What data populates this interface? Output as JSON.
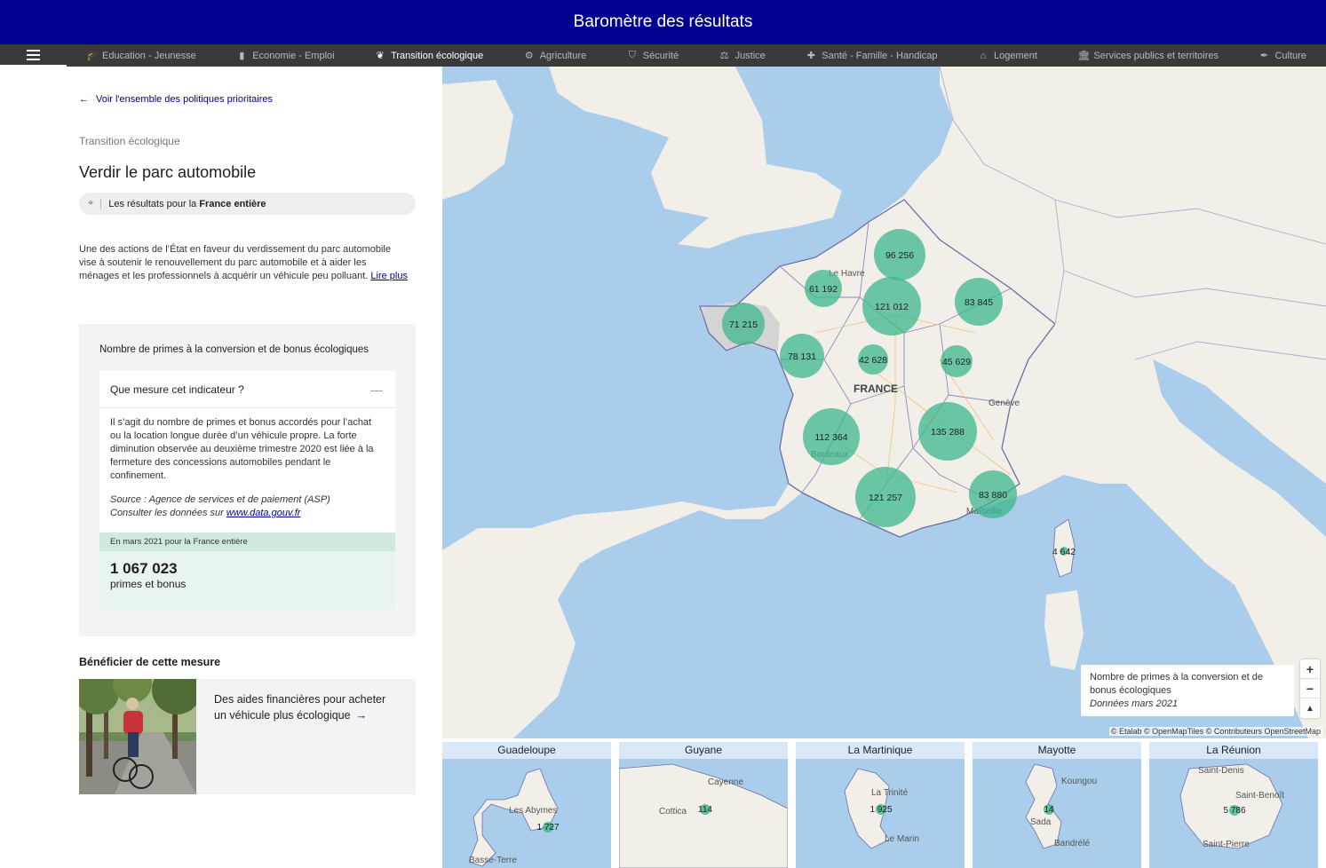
{
  "header": {
    "title": "Baromètre des résultats"
  },
  "nav": {
    "items": [
      {
        "label": "Education - Jeunesse",
        "icon": "graduation-cap-icon",
        "glyph": "🎓",
        "active": false
      },
      {
        "label": "Economie - Emploi",
        "icon": "briefcase-icon",
        "glyph": "▮",
        "active": false
      },
      {
        "label": "Transition écologique",
        "icon": "leaf-icon",
        "glyph": "❦",
        "active": true
      },
      {
        "label": "Agriculture",
        "icon": "tractor-icon",
        "glyph": "⚙",
        "active": false
      },
      {
        "label": "Sécurité",
        "icon": "shield-icon",
        "glyph": "⛉",
        "active": false
      },
      {
        "label": "Justice",
        "icon": "scale-icon",
        "glyph": "⚖",
        "active": false
      },
      {
        "label": "Santé - Famille - Handicap",
        "icon": "medical-case-icon",
        "glyph": "✚",
        "active": false
      },
      {
        "label": "Logement",
        "icon": "home-icon",
        "glyph": "⌂",
        "active": false
      },
      {
        "label": "Services publics et territoires",
        "icon": "building-icon",
        "glyph": "🏛",
        "active": false
      },
      {
        "label": "Culture",
        "icon": "feather-icon",
        "glyph": "✒",
        "active": false
      }
    ]
  },
  "sidebar": {
    "back_link": "Voir l'ensemble des politiques prioritaires",
    "category": "Transition écologique",
    "title": "Verdir le parc automobile",
    "scope_prefix": "Les résultats pour la",
    "scope_value": "France entière",
    "intro": "Une des actions de l’État en faveur du verdissement du parc automobile vise à soutenir le renouvellement du parc automobile et à aider les ménages et les professionnels à acquérir un véhicule peu polluant.",
    "read_more": "Lire plus",
    "indicator": {
      "title": "Nombre de primes à la conversion et de bonus écologiques",
      "accordion_title": "Que mesure cet indicateur ?",
      "description": "Il s’agit du nombre de primes et bonus accordés pour l’achat ou la location longue durée d’un véhicule propre. La forte diminution observée au deuxième trimestre 2020 est liée à la fermeture des concessions automobiles pendant le confinement.",
      "source": "Source : Agence de services et de paiement (ASP)",
      "data_prefix": "Consulter les données sur",
      "data_link": "www.data.gouv.fr",
      "value_caption": "En mars 2021 pour la France entière",
      "value": "1 067 023",
      "unit": "primes et bonus"
    },
    "benefit": {
      "title": "Bénéficier de cette mesure",
      "card_text": "Des aides financières pour acheter un véhicule plus écologique"
    }
  },
  "map": {
    "country_label": "FRANCE",
    "city_labels": [
      "Le Havre",
      "Bordeaux",
      "Genève",
      "Marseille"
    ],
    "clusters": [
      "96 256",
      "61 192",
      "121 012",
      "83 845",
      "71 215",
      "78 131",
      "42 628",
      "45 629",
      "112 364",
      "135 288",
      "121 257",
      "83 880",
      "4 642"
    ],
    "legend_title": "Nombre de primes à la conversion et de bonus écologiques",
    "legend_date": "Données mars 2021",
    "zoom_in": "+",
    "zoom_out": "−",
    "reset_north": "▲",
    "attribution": "© Etalab © OpenMapTiles © Contributeurs OpenStreetMap",
    "colors": {
      "sea": "#a9cdea",
      "land": "#f2efe9",
      "cluster": "#3cb78c",
      "highlight": "#d4d4d4"
    }
  },
  "overseas": [
    {
      "name": "Guadeloupe",
      "value": "1 727",
      "places": [
        "Les Abymes",
        "Basse-Terre"
      ]
    },
    {
      "name": "Guyane",
      "value": "114",
      "places": [
        "Cayenne",
        "Cottica"
      ]
    },
    {
      "name": "La Martinique",
      "value": "1 925",
      "places": [
        "La Trinité",
        "Le Marin"
      ]
    },
    {
      "name": "Mayotte",
      "value": "14",
      "places": [
        "Koungou",
        "Sada",
        "Bandrélé"
      ]
    },
    {
      "name": "La Réunion",
      "value": "5 786",
      "places": [
        "Saint-Denis",
        "Saint-Benoît",
        "Saint-Pierre"
      ]
    }
  ]
}
